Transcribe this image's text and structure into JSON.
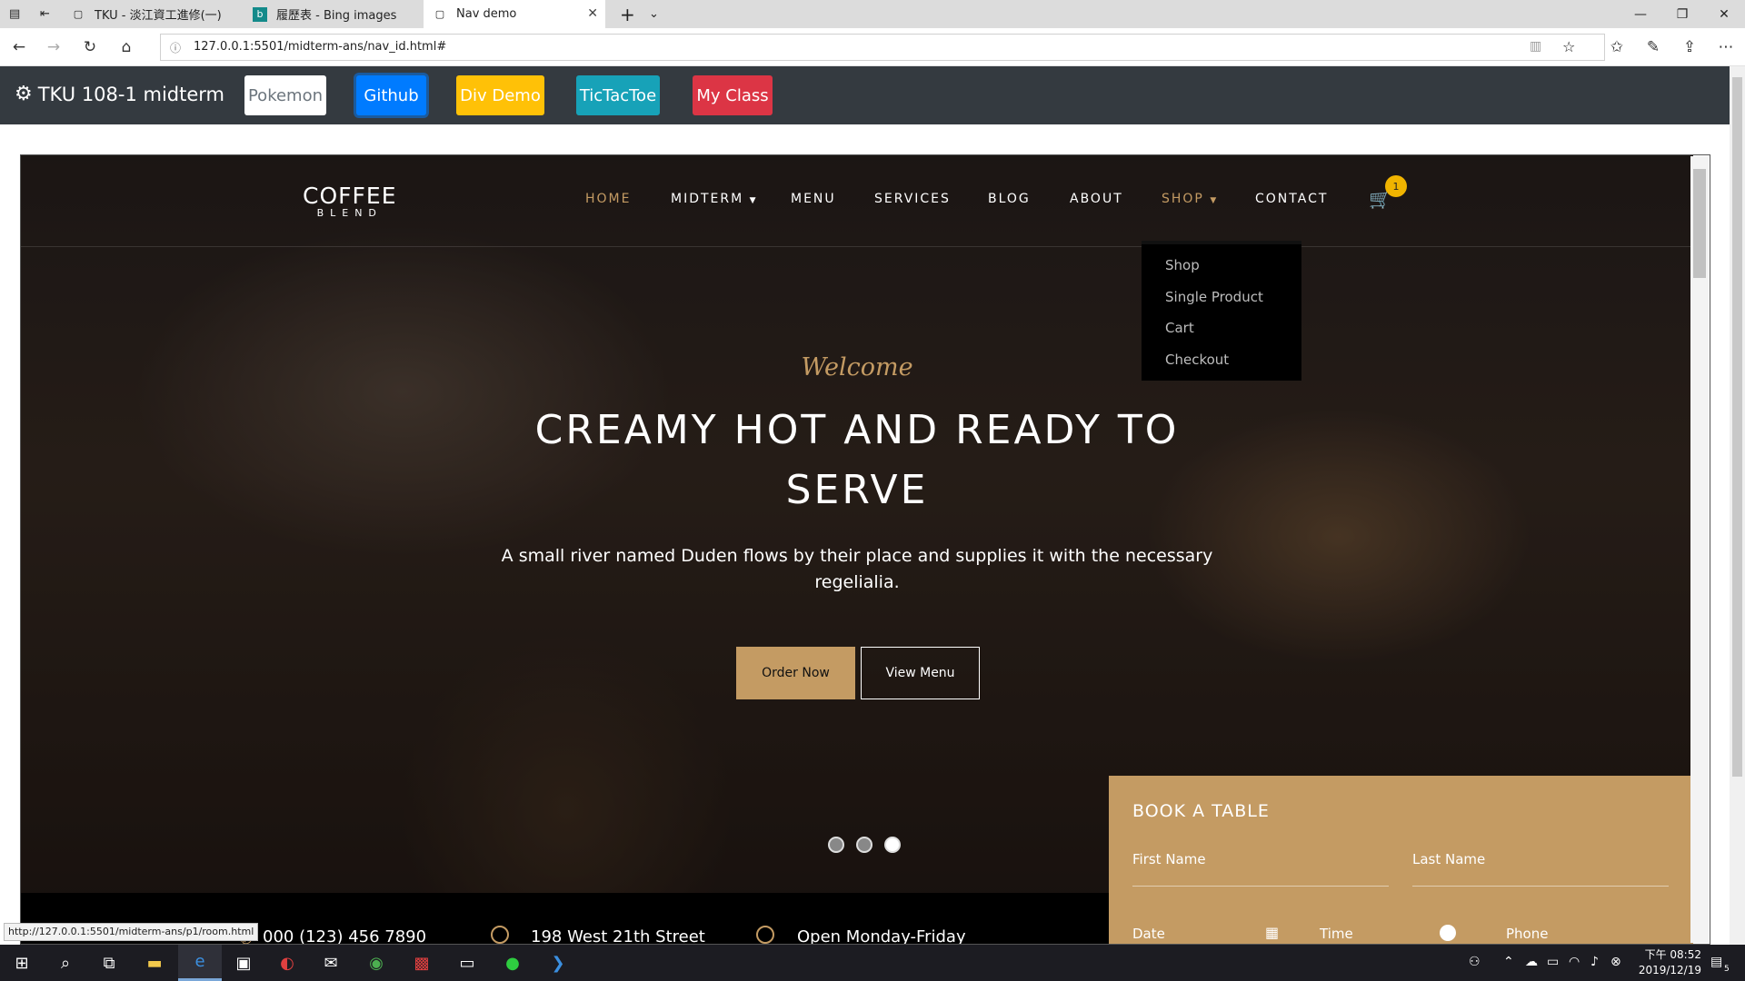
{
  "browser": {
    "tabs": [
      {
        "title": "TKU - 淡江資工進修(一)",
        "icon": "page-icon"
      },
      {
        "title": "履歷表 - Bing images",
        "icon": "bing-icon"
      },
      {
        "title": "Nav demo",
        "icon": "page-icon",
        "active": true
      }
    ],
    "new_tab": "+",
    "tab_list": "⌄",
    "url": "127.0.0.1:5501/midterm-ans/nav_id.html#",
    "status_url": "http://127.0.0.1:5501/midterm-ans/p1/room.html"
  },
  "site_nav": {
    "brand": "TKU 108-1 midterm",
    "buttons": [
      {
        "label": "Pokemon",
        "bg": "#ffffff",
        "fg": "#6c757d"
      },
      {
        "label": "Github",
        "bg": "#007bff",
        "fg": "#ffffff"
      },
      {
        "label": "Div Demo",
        "bg": "#ffc107",
        "fg": "#ffffff"
      },
      {
        "label": "TicTacToe",
        "bg": "#17a2b8",
        "fg": "#ffffff"
      },
      {
        "label": "My Class",
        "bg": "#dc3545",
        "fg": "#ffffff"
      }
    ]
  },
  "coffee": {
    "logo_top": "COFFEE",
    "logo_bottom": "BLEND",
    "menu": [
      "HOME",
      "MIDTERM",
      "MENU",
      "SERVICES",
      "BLOG",
      "ABOUT",
      "SHOP",
      "CONTACT"
    ],
    "cart_count": "1",
    "shop_dropdown": [
      "Shop",
      "Single Product",
      "Cart",
      "Checkout"
    ],
    "welcome": "Welcome",
    "headline": "CREAMY HOT AND READY TO SERVE",
    "subtext": "A small river named Duden flows by their place and supplies it with the necessary regelialia.",
    "order_btn": "Order Now",
    "view_btn": "View Menu",
    "slide_dots": 3,
    "active_slide": 3,
    "info": {
      "phone": "000 (123) 456 7890",
      "address": "198 West 21th Street",
      "hours": "Open Monday-Friday"
    },
    "book": {
      "title": "BOOK A TABLE",
      "first_name": "First Name",
      "last_name": "Last Name",
      "date": "Date",
      "time": "Time",
      "phone": "Phone"
    },
    "accent": "#c49b63"
  },
  "taskbar": {
    "time": "下午 08:52",
    "date": "2019/12/19",
    "notification_count": "5"
  }
}
